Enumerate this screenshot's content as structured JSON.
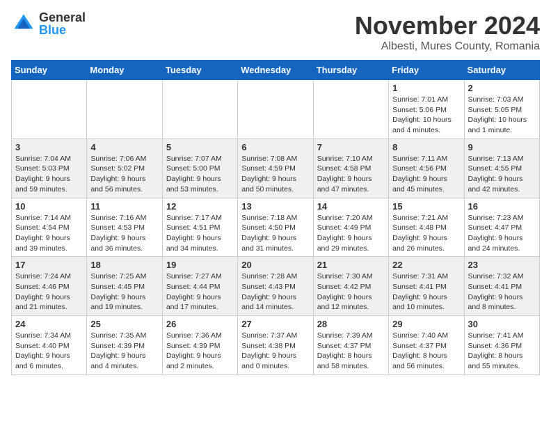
{
  "logo": {
    "general": "General",
    "blue": "Blue"
  },
  "title": "November 2024",
  "subtitle": "Albesti, Mures County, Romania",
  "days_of_week": [
    "Sunday",
    "Monday",
    "Tuesday",
    "Wednesday",
    "Thursday",
    "Friday",
    "Saturday"
  ],
  "weeks": [
    [
      {
        "day": "",
        "info": ""
      },
      {
        "day": "",
        "info": ""
      },
      {
        "day": "",
        "info": ""
      },
      {
        "day": "",
        "info": ""
      },
      {
        "day": "",
        "info": ""
      },
      {
        "day": "1",
        "info": "Sunrise: 7:01 AM\nSunset: 5:06 PM\nDaylight: 10 hours and 4 minutes."
      },
      {
        "day": "2",
        "info": "Sunrise: 7:03 AM\nSunset: 5:05 PM\nDaylight: 10 hours and 1 minute."
      }
    ],
    [
      {
        "day": "3",
        "info": "Sunrise: 7:04 AM\nSunset: 5:03 PM\nDaylight: 9 hours and 59 minutes."
      },
      {
        "day": "4",
        "info": "Sunrise: 7:06 AM\nSunset: 5:02 PM\nDaylight: 9 hours and 56 minutes."
      },
      {
        "day": "5",
        "info": "Sunrise: 7:07 AM\nSunset: 5:00 PM\nDaylight: 9 hours and 53 minutes."
      },
      {
        "day": "6",
        "info": "Sunrise: 7:08 AM\nSunset: 4:59 PM\nDaylight: 9 hours and 50 minutes."
      },
      {
        "day": "7",
        "info": "Sunrise: 7:10 AM\nSunset: 4:58 PM\nDaylight: 9 hours and 47 minutes."
      },
      {
        "day": "8",
        "info": "Sunrise: 7:11 AM\nSunset: 4:56 PM\nDaylight: 9 hours and 45 minutes."
      },
      {
        "day": "9",
        "info": "Sunrise: 7:13 AM\nSunset: 4:55 PM\nDaylight: 9 hours and 42 minutes."
      }
    ],
    [
      {
        "day": "10",
        "info": "Sunrise: 7:14 AM\nSunset: 4:54 PM\nDaylight: 9 hours and 39 minutes."
      },
      {
        "day": "11",
        "info": "Sunrise: 7:16 AM\nSunset: 4:53 PM\nDaylight: 9 hours and 36 minutes."
      },
      {
        "day": "12",
        "info": "Sunrise: 7:17 AM\nSunset: 4:51 PM\nDaylight: 9 hours and 34 minutes."
      },
      {
        "day": "13",
        "info": "Sunrise: 7:18 AM\nSunset: 4:50 PM\nDaylight: 9 hours and 31 minutes."
      },
      {
        "day": "14",
        "info": "Sunrise: 7:20 AM\nSunset: 4:49 PM\nDaylight: 9 hours and 29 minutes."
      },
      {
        "day": "15",
        "info": "Sunrise: 7:21 AM\nSunset: 4:48 PM\nDaylight: 9 hours and 26 minutes."
      },
      {
        "day": "16",
        "info": "Sunrise: 7:23 AM\nSunset: 4:47 PM\nDaylight: 9 hours and 24 minutes."
      }
    ],
    [
      {
        "day": "17",
        "info": "Sunrise: 7:24 AM\nSunset: 4:46 PM\nDaylight: 9 hours and 21 minutes."
      },
      {
        "day": "18",
        "info": "Sunrise: 7:25 AM\nSunset: 4:45 PM\nDaylight: 9 hours and 19 minutes."
      },
      {
        "day": "19",
        "info": "Sunrise: 7:27 AM\nSunset: 4:44 PM\nDaylight: 9 hours and 17 minutes."
      },
      {
        "day": "20",
        "info": "Sunrise: 7:28 AM\nSunset: 4:43 PM\nDaylight: 9 hours and 14 minutes."
      },
      {
        "day": "21",
        "info": "Sunrise: 7:30 AM\nSunset: 4:42 PM\nDaylight: 9 hours and 12 minutes."
      },
      {
        "day": "22",
        "info": "Sunrise: 7:31 AM\nSunset: 4:41 PM\nDaylight: 9 hours and 10 minutes."
      },
      {
        "day": "23",
        "info": "Sunrise: 7:32 AM\nSunset: 4:41 PM\nDaylight: 9 hours and 8 minutes."
      }
    ],
    [
      {
        "day": "24",
        "info": "Sunrise: 7:34 AM\nSunset: 4:40 PM\nDaylight: 9 hours and 6 minutes."
      },
      {
        "day": "25",
        "info": "Sunrise: 7:35 AM\nSunset: 4:39 PM\nDaylight: 9 hours and 4 minutes."
      },
      {
        "day": "26",
        "info": "Sunrise: 7:36 AM\nSunset: 4:39 PM\nDaylight: 9 hours and 2 minutes."
      },
      {
        "day": "27",
        "info": "Sunrise: 7:37 AM\nSunset: 4:38 PM\nDaylight: 9 hours and 0 minutes."
      },
      {
        "day": "28",
        "info": "Sunrise: 7:39 AM\nSunset: 4:37 PM\nDaylight: 8 hours and 58 minutes."
      },
      {
        "day": "29",
        "info": "Sunrise: 7:40 AM\nSunset: 4:37 PM\nDaylight: 8 hours and 56 minutes."
      },
      {
        "day": "30",
        "info": "Sunrise: 7:41 AM\nSunset: 4:36 PM\nDaylight: 8 hours and 55 minutes."
      }
    ]
  ]
}
